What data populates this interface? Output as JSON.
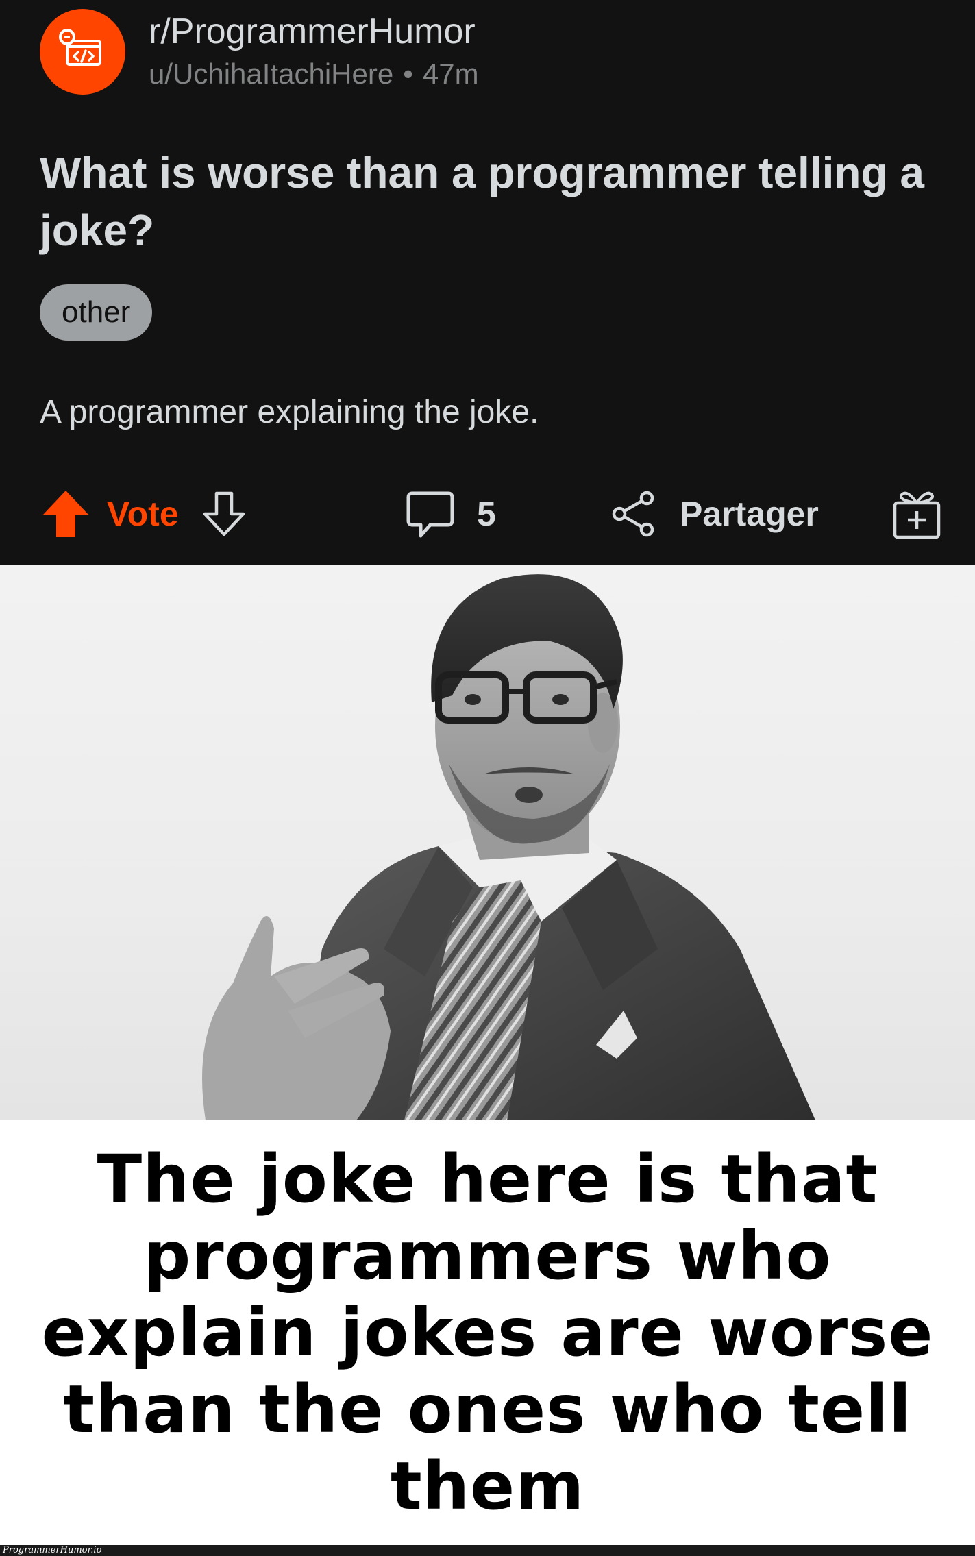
{
  "post": {
    "subreddit": "r/ProgrammerHumor",
    "author": "u/UchihaItachiHere",
    "separator": "•",
    "age": "47m",
    "title": "What is worse than a programmer telling a joke?",
    "flair": "other",
    "body": "A programmer explaining the joke.",
    "icons": {
      "subreddit_avatar": "programmer-humor-logo-icon",
      "upvote": "upvote-arrow-icon",
      "downvote": "downvote-arrow-icon",
      "comments": "comment-bubble-icon",
      "share": "share-icon",
      "award": "award-gift-icon"
    },
    "actions": {
      "vote_label": "Vote",
      "comment_count": "5",
      "share_label": "Partager"
    },
    "colors": {
      "background": "#121212",
      "accent": "#ff4500",
      "text": "#d7dadc",
      "muted": "#818384",
      "flair_bg": "#9da1a4"
    }
  },
  "meme": {
    "image": "black-and-white-photo-man-in-suit-pointing-at-self",
    "caption": "The joke here is that programmers who explain jokes are worse than the ones who tell them"
  },
  "watermark": {
    "text": "ProgrammerHumor.io"
  }
}
